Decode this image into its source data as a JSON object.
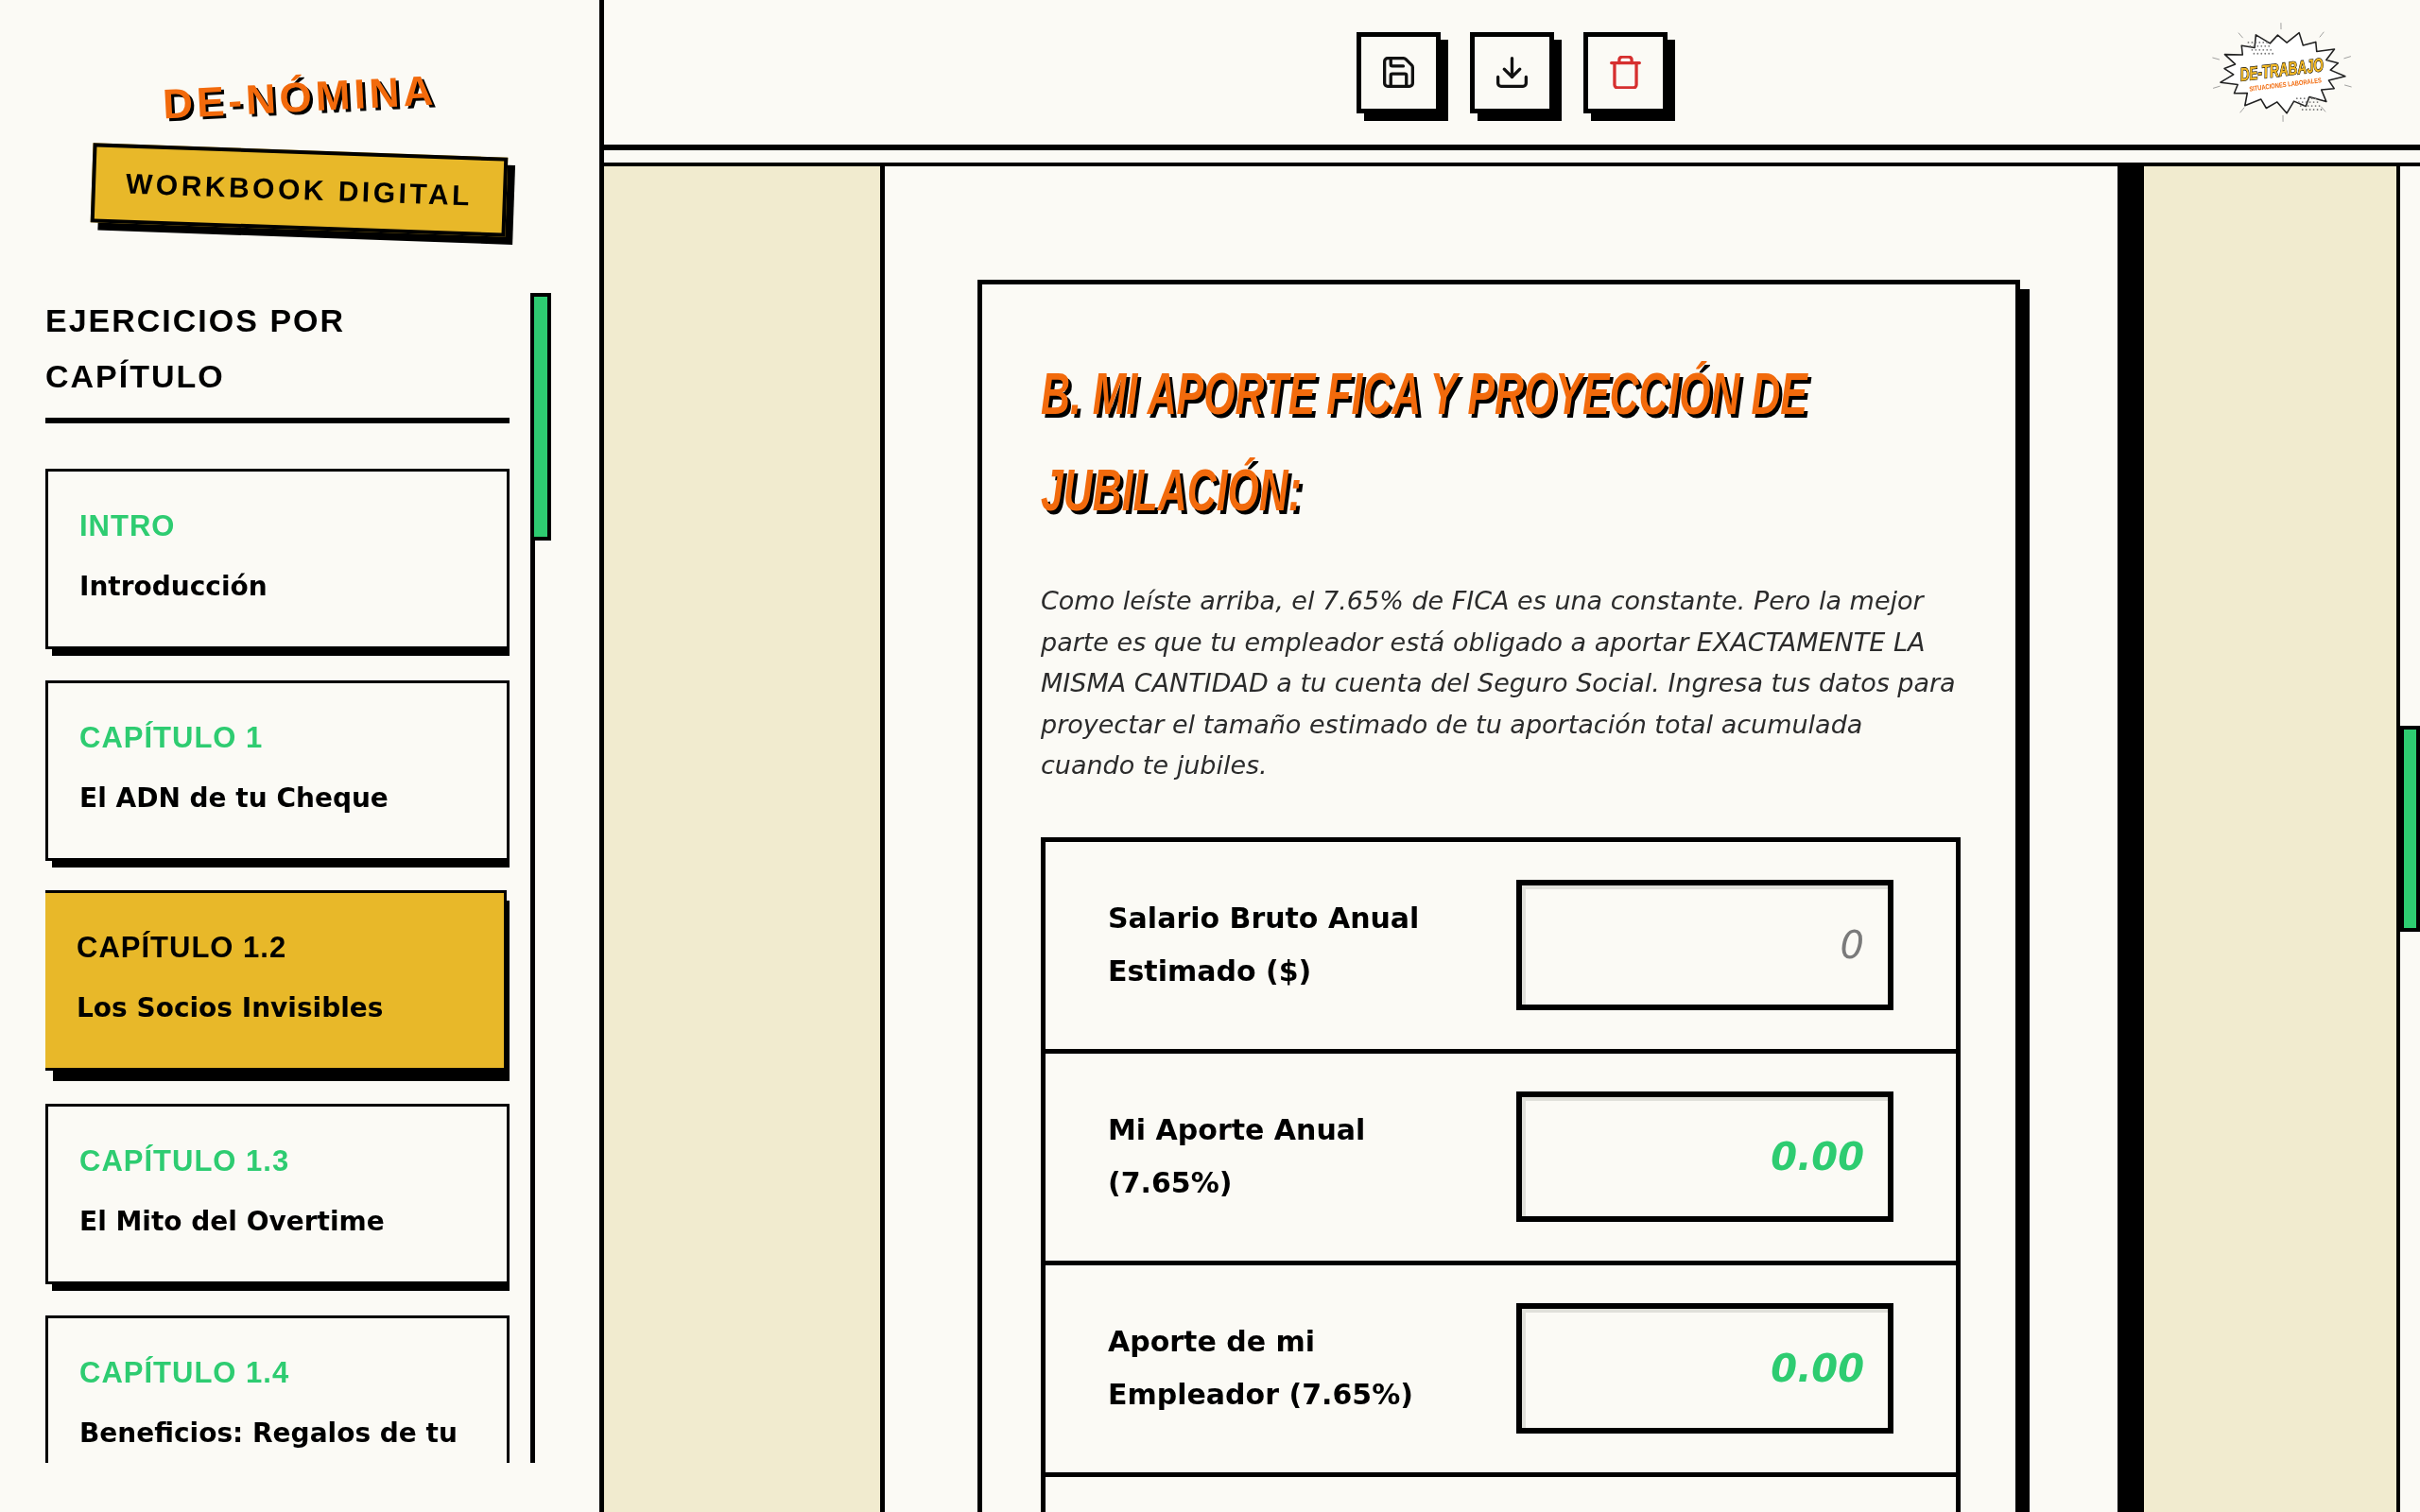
{
  "sidebar": {
    "brand": {
      "title": "DE-NÓMINA",
      "subtitle": "WORKBOOK DIGITAL"
    },
    "section_title": "EJERCICIOS POR CAPÍTULO",
    "chapters": [
      {
        "label": "INTRO",
        "title": "Introducción",
        "selected": false
      },
      {
        "label": "CAPÍTULO 1",
        "title": "El ADN de tu Cheque",
        "selected": false
      },
      {
        "label": "CAPÍTULO 1.2",
        "title": "Los Socios Invisibles",
        "selected": true
      },
      {
        "label": "CAPÍTULO 1.3",
        "title": "El Mito del Overtime",
        "selected": false
      },
      {
        "label": "CAPÍTULO 1.4",
        "title": "Beneficios: Regalos de tu",
        "selected": false
      }
    ]
  },
  "toolbar": {
    "buttons": [
      {
        "kind": "save"
      },
      {
        "kind": "download"
      },
      {
        "kind": "delete"
      }
    ],
    "logo": {
      "title": "DE-TRABAJO",
      "subtitle": "SITUACIONES LABORALES"
    }
  },
  "exercise": {
    "heading": "B. MI APORTE FICA Y PROYECCIÓN DE JUBILACIÓN:",
    "intro": "Como leíste arriba, el 7.65% de FICA es una constante. Pero la mejor parte es que tu empleador está obligado a aportar EXACTAMENTE LA MISMA CANTIDAD a tu cuenta del Seguro Social. Ingresa tus datos para proyectar el tamaño estimado de tu aportación total acumulada cuando te jubiles.",
    "fields": [
      {
        "label": "Salario Bruto Anual Estimado ($)",
        "kind": "input",
        "placeholder": "0"
      },
      {
        "label": "Mi Aporte Anual (7.65%)",
        "kind": "output",
        "value": "0.00"
      },
      {
        "label": "Aporte de mi Empleador (7.65%)",
        "kind": "output",
        "value": "0.00"
      }
    ]
  }
}
